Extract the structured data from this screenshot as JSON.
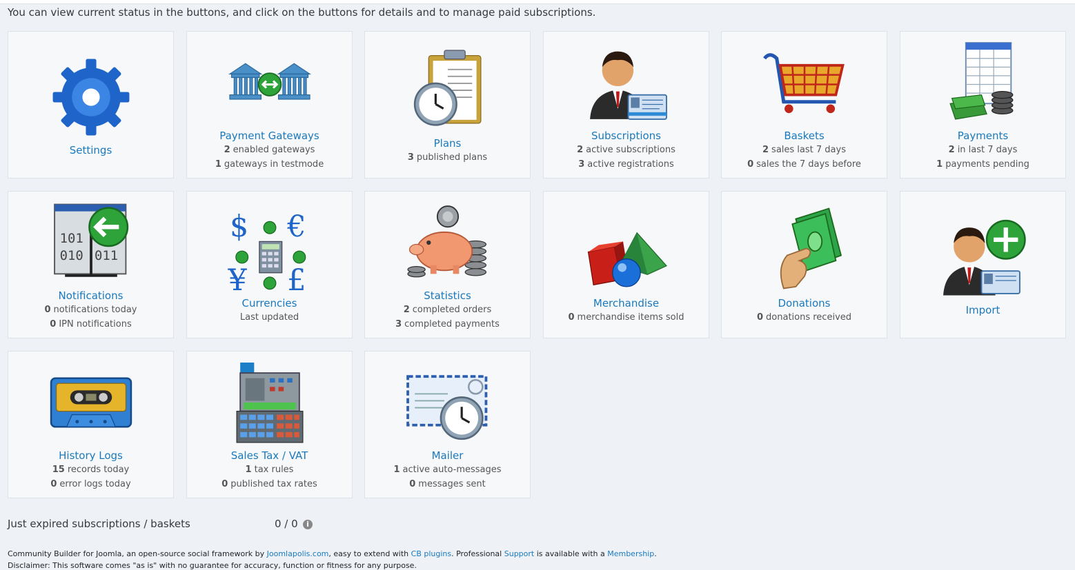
{
  "intro": "You can view current status in the buttons, and click on the buttons for details and to manage paid subscriptions.",
  "tiles": {
    "settings": {
      "title": "Settings"
    },
    "gateways": {
      "title": "Payment Gateways",
      "l1n": "2",
      "l1t": "enabled gateways",
      "l2n": "1",
      "l2t": "gateways in testmode"
    },
    "plans": {
      "title": "Plans",
      "l1n": "3",
      "l1t": "published plans"
    },
    "subscriptions": {
      "title": "Subscriptions",
      "l1n": "2",
      "l1t": "active subscriptions",
      "l2n": "3",
      "l2t": "active registrations"
    },
    "baskets": {
      "title": "Baskets",
      "l1n": "2",
      "l1t": "sales last 7 days",
      "l2n": "0",
      "l2t": "sales the 7 days before"
    },
    "payments": {
      "title": "Payments",
      "l1n": "2",
      "l1t": "in last 7 days",
      "l2n": "1",
      "l2t": "payments pending"
    },
    "notifications": {
      "title": "Notifications",
      "l1n": "0",
      "l1t": "notifications today",
      "l2n": "0",
      "l2t": "IPN notifications"
    },
    "currencies": {
      "title": "Currencies",
      "l1t": "Last updated"
    },
    "statistics": {
      "title": "Statistics",
      "l1n": "2",
      "l1t": "completed orders",
      "l2n": "3",
      "l2t": "completed payments"
    },
    "merchandise": {
      "title": "Merchandise",
      "l1n": "0",
      "l1t": "merchandise items sold"
    },
    "donations": {
      "title": "Donations",
      "l1n": "0",
      "l1t": "donations received"
    },
    "import": {
      "title": "Import"
    },
    "history": {
      "title": "History Logs",
      "l1n": "15",
      "l1t": "records today",
      "l2n": "0",
      "l2t": "error logs today"
    },
    "tax": {
      "title": "Sales Tax / VAT",
      "l1n": "1",
      "l1t": "tax rules",
      "l2n": "0",
      "l2t": "published tax rates"
    },
    "mailer": {
      "title": "Mailer",
      "l1n": "1",
      "l1t": "active auto-messages",
      "l2n": "0",
      "l2t": "messages sent"
    }
  },
  "icons": {
    "settings": "gear-icon",
    "gateways": "bank-transfer-icon",
    "plans": "clipboard-clock-icon",
    "subscriptions": "user-card-icon",
    "baskets": "shopping-cart-icon",
    "payments": "spreadsheet-money-icon",
    "notifications": "binary-window-icon",
    "currencies": "currency-symbols-icon",
    "statistics": "piggy-bank-icon",
    "merchandise": "shapes-icon",
    "donations": "hand-money-icon",
    "import": "user-add-icon",
    "history": "cassette-icon",
    "tax": "cash-register-icon",
    "mailer": "envelope-clock-icon"
  },
  "expired": {
    "label": "Just expired subscriptions / baskets",
    "value": "0 / 0"
  },
  "footer": {
    "t1": "Community Builder for Joomla, an open-source social framework by ",
    "link1": "Joomlapolis.com",
    "t2": ", easy to extend with ",
    "link2": "CB plugins",
    "t3": ". Professional ",
    "link3": "Support",
    "t4": " is available with a ",
    "link4": "Membership",
    "t5": ".",
    "line2": "Disclaimer: This software comes \"as is\" with no guarantee for accuracy, function or fitness for any purpose."
  },
  "colors": {
    "link": "#1a79bd",
    "tile_bg": "#f6f8fa",
    "page_bg": "#eef2f6"
  }
}
